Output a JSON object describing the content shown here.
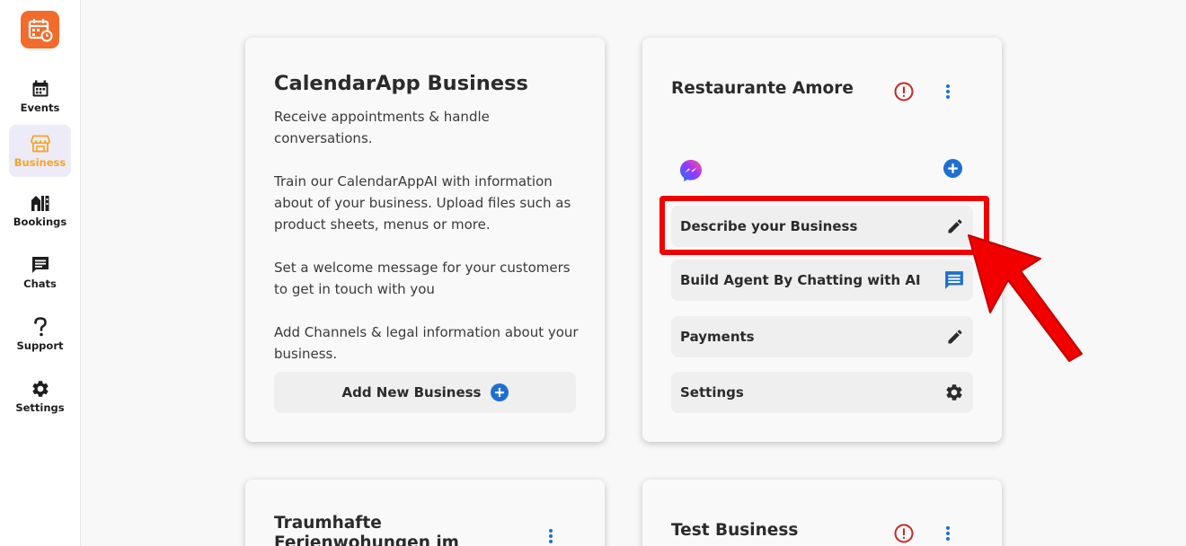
{
  "sidebar": {
    "logo_icon": "calendar-logo-icon",
    "items": [
      {
        "label": "Events",
        "icon": "calendar-icon"
      },
      {
        "label": "Business",
        "icon": "store-icon"
      },
      {
        "label": "Bookings",
        "icon": "building-icon"
      },
      {
        "label": "Chats",
        "icon": "chat-icon"
      },
      {
        "label": "Support",
        "icon": "question-icon"
      },
      {
        "label": "Settings",
        "icon": "gear-icon"
      }
    ]
  },
  "intro_card": {
    "title": "CalendarApp Business",
    "paragraphs": [
      "Receive appointments & handle conversations.",
      "Train our CalendarAppAI with information about of your business. Upload files such as product sheets, menus or more.",
      "Set a welcome message for your customers to get in touch with you",
      "Add Channels & legal information about your business."
    ],
    "add_button_label": "Add New Business"
  },
  "business_card": {
    "title": "Restaurante Amore",
    "channel_icon": "messenger-icon",
    "rows": [
      {
        "label": "Describe your Business",
        "icon": "pencil-icon"
      },
      {
        "label": "Build Agent By Chatting with AI",
        "icon": "chat-icon"
      },
      {
        "label": "Payments",
        "icon": "pencil-icon"
      },
      {
        "label": "Settings",
        "icon": "gear-icon"
      }
    ]
  },
  "lower_cards": [
    {
      "title": "Traumhafte Ferienwohungen im Bayrischen Wald"
    },
    {
      "title": "Test Business"
    }
  ],
  "colors": {
    "brand": "#f26b2c",
    "active_label": "#f5a623",
    "accent_blue": "#1e6fd1",
    "alert_red": "#c62828",
    "highlight": "#f20000"
  }
}
